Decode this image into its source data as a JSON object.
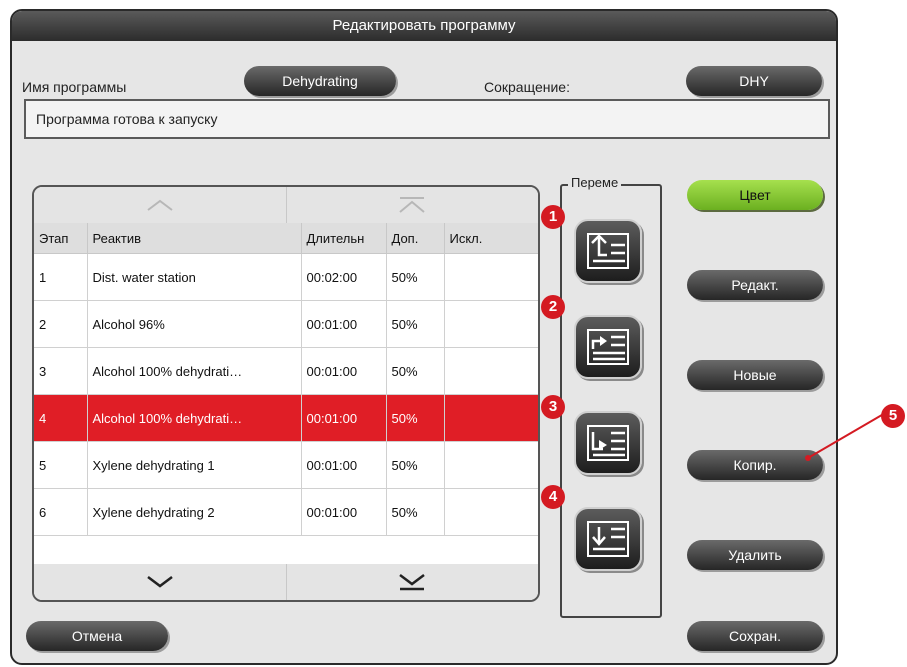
{
  "window": {
    "title": "Редактировать программу"
  },
  "header": {
    "program_name_label": "Имя программы",
    "program_name_value": "Dehydrating",
    "abbreviation_label": "Сокращение:",
    "abbreviation_value": "DHY"
  },
  "status_text": "Программа готова к запуску",
  "table": {
    "columns": [
      "Этап",
      "Реактив",
      "Длительн",
      "Доп.",
      "Искл."
    ],
    "rows": [
      {
        "step": "1",
        "reagent": "Dist. water station",
        "duration": "00:02:00",
        "extra": "50%",
        "excl": ""
      },
      {
        "step": "2",
        "reagent": "Alcohol 96%",
        "duration": "00:01:00",
        "extra": "50%",
        "excl": ""
      },
      {
        "step": "3",
        "reagent": "Alcohol 100% dehydrati…",
        "duration": "00:01:00",
        "extra": "50%",
        "excl": ""
      },
      {
        "step": "4",
        "reagent": "Alcohol 100% dehydrati…",
        "duration": "00:01:00",
        "extra": "50%",
        "excl": ""
      },
      {
        "step": "5",
        "reagent": "Xylene dehydrating 1",
        "duration": "00:01:00",
        "extra": "50%",
        "excl": ""
      },
      {
        "step": "6",
        "reagent": "Xylene dehydrating 2",
        "duration": "00:01:00",
        "extra": "50%",
        "excl": ""
      }
    ],
    "selected_row": 3
  },
  "move_group": {
    "title": "Переме",
    "buttons": [
      {
        "icon": "insert-row-above-icon",
        "badge": "1"
      },
      {
        "icon": "insert-row-below-icon",
        "badge": "2"
      },
      {
        "icon": "insert-row-copy-icon",
        "badge": "3"
      },
      {
        "icon": "insert-row-bottom-icon",
        "badge": "4"
      }
    ]
  },
  "actions": {
    "color": "Цвет",
    "edit": "Редакт.",
    "new": "Новые",
    "copy": "Копир.",
    "delete": "Удалить",
    "cancel": "Отмена",
    "save": "Сохран."
  },
  "callout_badge": "5",
  "colors": {
    "selected_row": "#e01e26",
    "accent_green": "#8cc63f",
    "badge_red": "#d41a22"
  }
}
